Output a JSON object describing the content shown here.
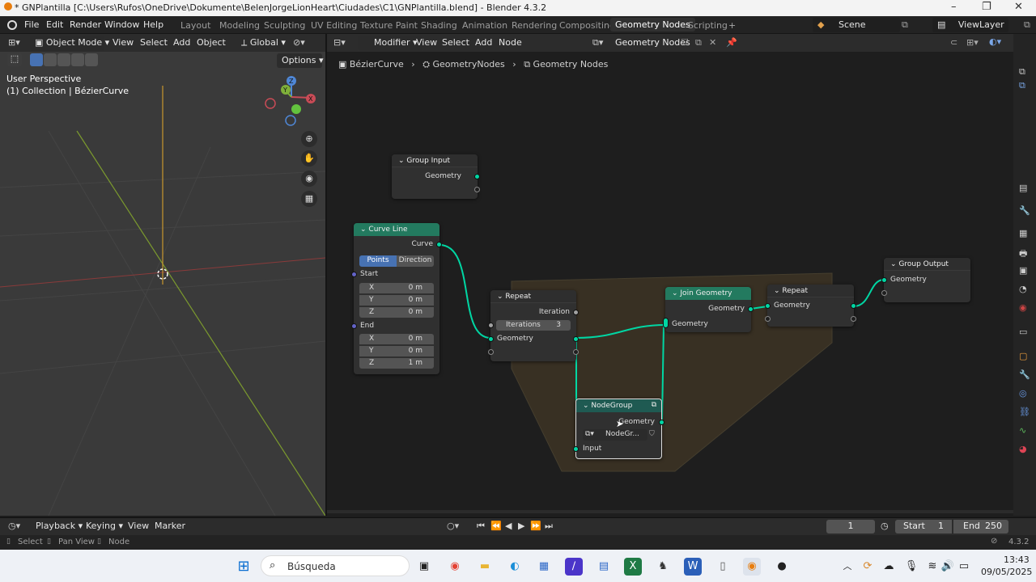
{
  "window": {
    "title": "* GNPlantilla [C:\\Users\\Rufos\\OneDrive\\Dokumente\\BelenJorgeLionHeart\\Ciudades\\C1\\GNPlantilla.blend] - Blender 4.3.2"
  },
  "menu": {
    "file": "File",
    "edit": "Edit",
    "render": "Render",
    "window": "Window",
    "help": "Help"
  },
  "workspaces": [
    "Layout",
    "Modeling",
    "Sculpting",
    "UV Editing",
    "Texture Paint",
    "Shading",
    "Animation",
    "Rendering",
    "Compositing",
    "Geometry Nodes",
    "Scripting"
  ],
  "scene": {
    "name": "Scene",
    "view_layer": "ViewLayer"
  },
  "viewport": {
    "mode": "Object Mode",
    "view": "View",
    "select": "Select",
    "add": "Add",
    "object": "Object",
    "orientation": "Global",
    "options": "Options",
    "overlay_title": "User Perspective",
    "overlay_sub": "(1) Collection | BézierCurve",
    "gizmo": {
      "x": "X",
      "y": "Y",
      "z": "Z"
    }
  },
  "node_editor": {
    "type": "Modifier",
    "view": "View",
    "select": "Select",
    "add": "Add",
    "node": "Node",
    "tree_name": "Geometry Nodes",
    "breadcrumb": [
      "BézierCurve",
      "GeometryNodes",
      "Geometry Nodes"
    ]
  },
  "nodes": {
    "group_input": {
      "title": "Group Input",
      "out": "Geometry"
    },
    "curve_line": {
      "title": "Curve Line",
      "out": "Curve",
      "mode_a": "Points",
      "mode_b": "Direction",
      "start": "Start",
      "end": "End",
      "sx": "X",
      "sy": "Y",
      "sz": "Z",
      "sxv": "0 m",
      "syv": "0 m",
      "szv": "0 m",
      "ex": "X",
      "ey": "Y",
      "ez": "Z",
      "exv": "0 m",
      "eyv": "0 m",
      "ezv": "1 m"
    },
    "repeat_in": {
      "title": "Repeat",
      "iteration": "Iteration",
      "iterations_label": "Iterations",
      "iterations_value": "3",
      "geometry": "Geometry"
    },
    "join": {
      "title": "Join Geometry",
      "out": "Geometry",
      "in": "Geometry"
    },
    "repeat_out": {
      "title": "Repeat",
      "geometry": "Geometry"
    },
    "group_output": {
      "title": "Group Output",
      "geometry": "Geometry"
    },
    "nodegroup": {
      "title": "NodeGroup",
      "out": "Geometry",
      "datablock": "NodeGr...",
      "in": "Input"
    }
  },
  "timeline": {
    "playback": "Playback",
    "keying": "Keying",
    "view": "View",
    "marker": "Marker",
    "current_frame": "1",
    "start_label": "Start",
    "start": "1",
    "end_label": "End",
    "end": "250"
  },
  "status": {
    "select": "Select",
    "pan": "Pan View",
    "node": "Node",
    "version": "4.3.2"
  },
  "taskbar": {
    "search": "Búsqueda",
    "time": "13:43",
    "date": "09/05/2025"
  },
  "colors": {
    "accent": "#4772b3",
    "socket_geometry": "#00d6a3",
    "node_green": "#237a5f",
    "zone": "#3b3324"
  }
}
